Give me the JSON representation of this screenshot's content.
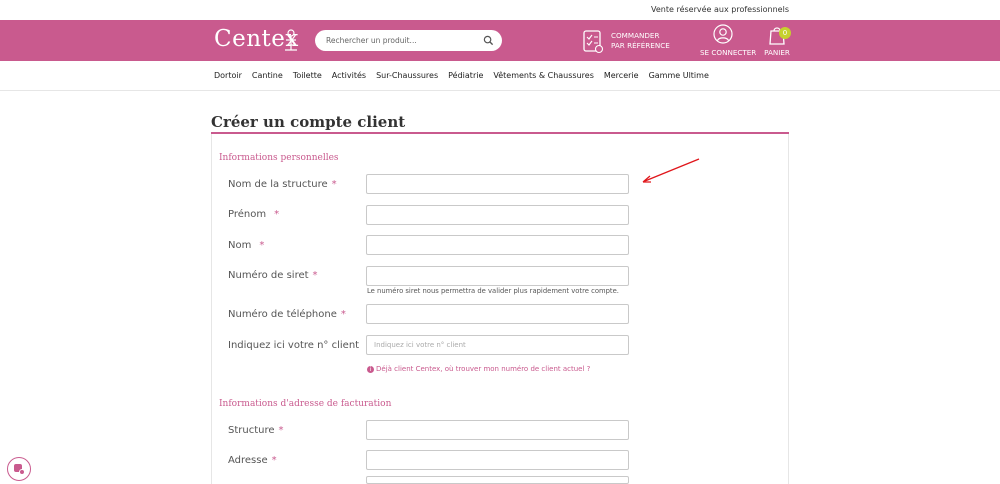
{
  "topbar": {
    "pro_text": "Vente réservée aux professionnels"
  },
  "header": {
    "logo": "Centex",
    "search_placeholder": "Rechercher un produit...",
    "order_by_ref_line1": "COMMANDER",
    "order_by_ref_line2": "PAR RÉFÉRENCE",
    "login_label": "SE CONNECTER",
    "cart_label": "PANIER",
    "cart_count": "0"
  },
  "nav": {
    "items": [
      "Dortoir",
      "Cantine",
      "Toilette",
      "Activités",
      "Sur-Chaussures",
      "Pédiatrie",
      "Vêtements & Chaussures",
      "Mercerie",
      "Gamme Ultime"
    ]
  },
  "form": {
    "title": "Créer un compte client",
    "required_mark": "*",
    "personal_section": "Informations personnelles",
    "structure_name": "Nom de la structure",
    "first_name": "Prénom",
    "last_name": "Nom",
    "siret": "Numéro de siret",
    "siret_help": "Le numéro siret nous permettra de valider plus rapidement votre compte.",
    "phone": "Numéro de téléphone",
    "client_number": "Indiquez ici votre n° client",
    "client_number_placeholder": "Indiquez ici votre n° client",
    "client_link": "Déjà client Centex, où trouver mon numéro de client actuel ?",
    "billing_section": "Informations d'adresse de facturation",
    "structure": "Structure",
    "address": "Adresse"
  },
  "colors": {
    "brand": "#c95a8e",
    "badge": "#c6d12e",
    "annotation_arrow": "#e0161b"
  }
}
